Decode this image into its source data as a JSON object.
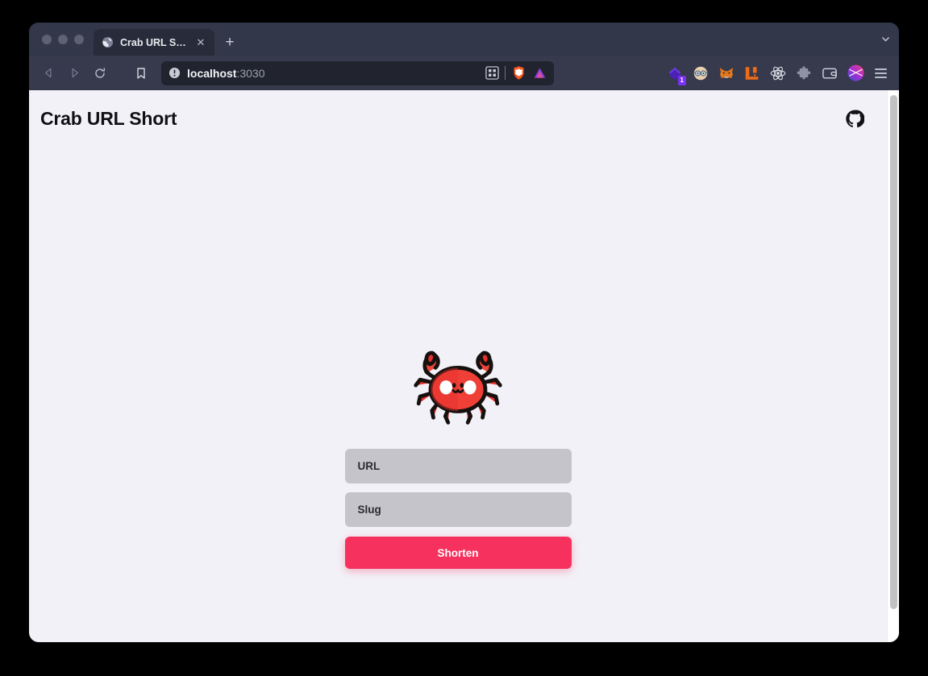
{
  "browser": {
    "window_controls": [
      "close",
      "minimize",
      "maximize"
    ],
    "tab": {
      "title": "Crab URL Short",
      "favicon": "globe-icon",
      "close_label": "✕"
    },
    "new_tab_label": "+",
    "tab_list_chevron": "chevron-down-icon",
    "nav": {
      "back": "back-arrow-icon",
      "forward": "forward-arrow-icon",
      "reload": "reload-icon",
      "bookmark": "bookmark-icon"
    },
    "address_bar": {
      "info_icon": "info-circle-icon",
      "host": "localhost",
      "port": ":3030",
      "qr_icon": "qr-code-icon",
      "shield_icon": "brave-shield-icon",
      "triangle_icon": "purple-triangle-icon"
    },
    "extensions": [
      {
        "name": "purple-diamond-extension-icon",
        "badge": "1"
      },
      {
        "name": "goggles-face-extension-icon",
        "badge": ""
      },
      {
        "name": "metamask-fox-extension-icon",
        "badge": ""
      },
      {
        "name": "orange-blocks-extension-icon",
        "badge": ""
      },
      {
        "name": "react-devtools-extension-icon",
        "badge": ""
      },
      {
        "name": "puzzle-piece-extensions-icon",
        "badge": ""
      },
      {
        "name": "wallet-extension-icon",
        "badge": ""
      },
      {
        "name": "profile-avatar-icon",
        "badge": ""
      }
    ],
    "menu_icon": "hamburger-menu-icon"
  },
  "page": {
    "title": "Crab URL Short",
    "github_icon": "github-icon",
    "mascot": "crab-mascot-illustration",
    "form": {
      "url_placeholder": "URL",
      "url_value": "",
      "slug_placeholder": "Slug",
      "slug_value": "",
      "submit_label": "Shorten"
    }
  },
  "colors": {
    "accent": "#f6315e",
    "page_background": "#f2f1f7",
    "input_background": "#c4c4ca",
    "browser_chrome": "#363a4c",
    "tab_active": "#282b39",
    "url_bar": "#21242f"
  }
}
